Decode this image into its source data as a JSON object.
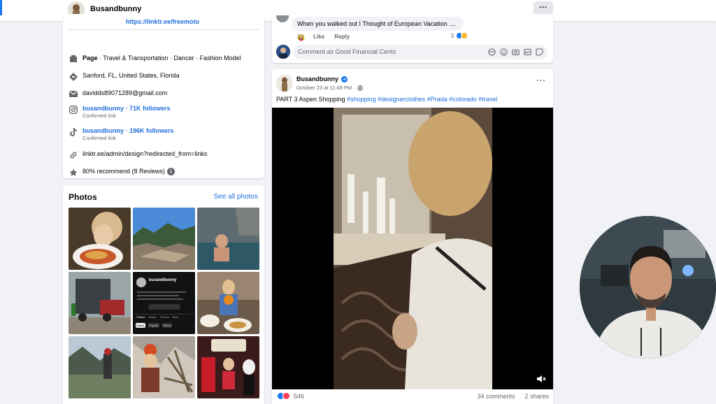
{
  "topbar": {
    "page_name": "Busandbunny",
    "more_label": "···"
  },
  "intro": {
    "top_link": "https://linktr.ee/freemoto",
    "category_prefix": "Page",
    "category_rest": " · Travel & Transportation · Dancer · Fashion Model",
    "location": "Sanford, FL, United States, Florida",
    "email": "davidds89071289@gmail.com",
    "instagram": {
      "text": "busandbunny · 71K followers",
      "sub": "Confirmed link"
    },
    "tiktok": {
      "text": "busandbunny · 196K followers",
      "sub": "Confirmed link"
    },
    "website": "linktr.ee/admin/design?redirected_from=links",
    "recommend": "80% recommend (8 Reviews)"
  },
  "photos": {
    "title": "Photos",
    "see_all": "See all photos",
    "screenshot_profile": {
      "name": "busandbunny",
      "tabs": [
        "Videos",
        "Shorts",
        "Photos",
        "Store"
      ],
      "chips": [
        "Latest",
        "Popular",
        "Oldest"
      ]
    }
  },
  "comment": {
    "text": "When you walked out I Thought of European Vacation .... 😜",
    "age": "3d",
    "like": "Like",
    "reply": "Reply",
    "reaction_count": "5",
    "input_placeholder": "Comment as Good Financial Cents"
  },
  "post": {
    "author": "Busandbunny",
    "date": "October 23 at 11:49 PM ·",
    "more_label": "···",
    "text_prefix": "PART 3 Aspen Shopping ",
    "hashtags": [
      "#shopping",
      "#designerclothes",
      "#Prada",
      "#colorado",
      "#travel"
    ],
    "reaction_count": "546",
    "comments": "34 comments",
    "shares": "2 shares"
  },
  "colors": {
    "accent": "#1877f2",
    "link": "#216fdb",
    "secondary_text": "#65676b",
    "page_bg": "#f0f2f5"
  },
  "icons": {
    "intro": [
      "page-icon",
      "location-icon",
      "email-icon",
      "instagram-icon",
      "tiktok-icon",
      "link-icon",
      "star-icon",
      "info-icon"
    ],
    "comment_input": [
      "avatar-sticker-icon",
      "emoji-icon",
      "camera-icon",
      "gif-icon",
      "sticker-icon"
    ]
  }
}
